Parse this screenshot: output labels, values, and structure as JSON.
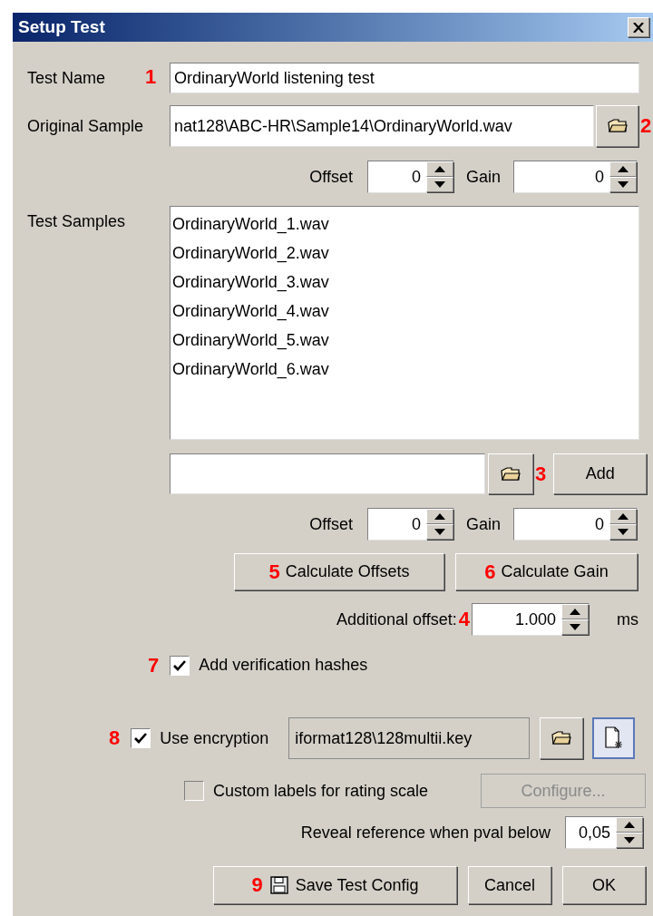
{
  "window": {
    "title": "Setup Test"
  },
  "test_name": {
    "label": "Test Name",
    "marker": "1",
    "value": "OrdinaryWorld listening test"
  },
  "original_sample": {
    "label": "Original Sample",
    "value": "nat128\\ABC-HR\\Sample14\\OrdinaryWorld.wav",
    "marker": "2",
    "offset": {
      "label": "Offset",
      "value": "0"
    },
    "gain": {
      "label": "Gain",
      "value": "0"
    }
  },
  "test_samples": {
    "label": "Test Samples",
    "items": [
      {
        "name": "OrdinaryWorld_1.wav"
      },
      {
        "name": "OrdinaryWorld_2.wav"
      },
      {
        "name": "OrdinaryWorld_3.wav"
      },
      {
        "name": "OrdinaryWorld_4.wav"
      },
      {
        "name": "OrdinaryWorld_5.wav"
      },
      {
        "name": "OrdinaryWorld_6.wav"
      }
    ],
    "marker": "3",
    "add_button": "Add",
    "offset": {
      "label": "Offset",
      "value": "0"
    },
    "gain": {
      "label": "Gain",
      "value": "0"
    }
  },
  "calculate_buttons": [
    {
      "marker": "5",
      "label": "Calculate Offsets"
    },
    {
      "marker": "6",
      "label": "Calculate Gain"
    }
  ],
  "additional_offset": {
    "label": "Additional offset:",
    "marker": "4",
    "value": "1.000",
    "unit": "ms"
  },
  "verification": {
    "marker": "7",
    "label": "Add verification hashes",
    "checked": true
  },
  "encryption": {
    "marker": "8",
    "label": "Use encryption",
    "checked": true,
    "key_file": "iformat128\\128multii.key",
    "new_key_pressed": true
  },
  "custom_labels": {
    "label": "Custom labels for rating scale",
    "checked": false,
    "configure_button": {
      "label": "Configure...",
      "disabled": true
    }
  },
  "reveal": {
    "label": "Reveal reference when pval below",
    "value": "0,05"
  },
  "buttons": [
    {
      "kind": "save",
      "marker": "9",
      "label": "Save Test Config"
    },
    {
      "kind": "plain",
      "label": "Cancel"
    },
    {
      "kind": "plain",
      "label": "OK"
    }
  ]
}
